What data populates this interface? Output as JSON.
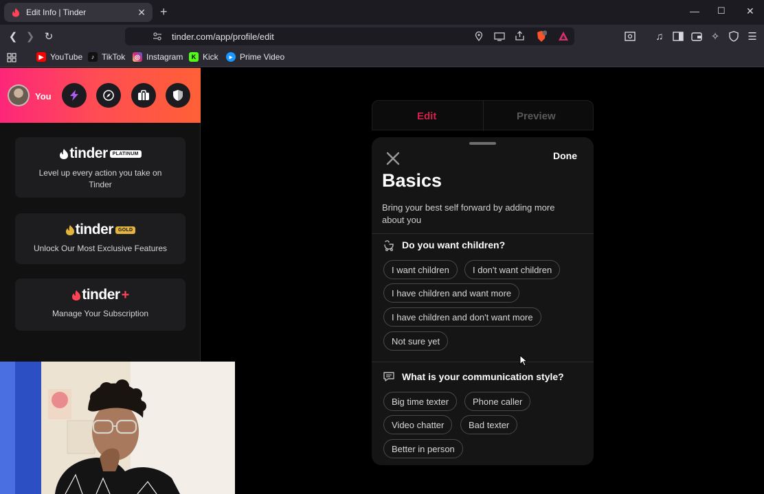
{
  "browser": {
    "tab_title": "Edit Info | Tinder",
    "url": "tinder.com/app/profile/edit",
    "bookmarks": [
      {
        "label": "YouTube",
        "icon": "youtube-icon",
        "color": "#ff0000"
      },
      {
        "label": "TikTok",
        "icon": "tiktok-icon",
        "color": "#111111"
      },
      {
        "label": "Instagram",
        "icon": "instagram-icon",
        "color": "#e1306c"
      },
      {
        "label": "Kick",
        "icon": "kick-icon",
        "color": "#53fc18"
      },
      {
        "label": "Prime Video",
        "icon": "prime-video-icon",
        "color": "#1a98ff"
      }
    ]
  },
  "sidebar": {
    "user_label": "You",
    "cards": [
      {
        "brand": "tinder",
        "badge": "PLATINUM",
        "text": "Level up every action you take on Tinder"
      },
      {
        "brand": "tinder",
        "badge": "GOLD",
        "text": "Unlock Our Most Exclusive Features"
      },
      {
        "brand": "tinder",
        "badge": "+",
        "text": "Manage Your Subscription"
      }
    ]
  },
  "editor": {
    "tabs": [
      "Edit",
      "Preview"
    ],
    "active_tab": "Edit",
    "accent_color": "#fd267a"
  },
  "modal": {
    "done_label": "Done",
    "title": "Basics",
    "description": "Bring your best self forward by adding more about you",
    "sections": [
      {
        "question": "Do you want children?",
        "icon": "baby-icon",
        "options": [
          "I want children",
          "I don't want children",
          "I have children and want more",
          "I have children and don't want more",
          "Not sure yet"
        ]
      },
      {
        "question": "What is your communication style?",
        "icon": "chat-icon",
        "options": [
          "Big time texter",
          "Phone caller",
          "Video chatter",
          "Bad texter",
          "Better in person"
        ]
      }
    ]
  }
}
